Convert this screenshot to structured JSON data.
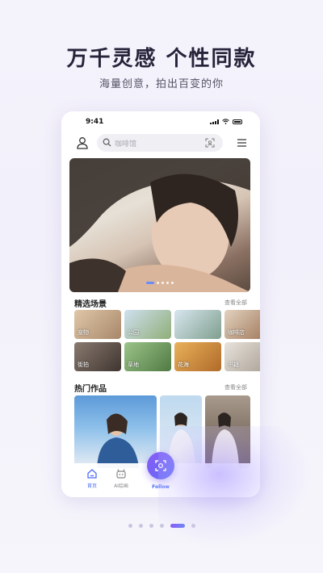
{
  "hero": {
    "title": "万千灵感 个性同款",
    "subtitle": "海量创意，拍出百变的你"
  },
  "status_bar": {
    "time": "9:41"
  },
  "search": {
    "placeholder": "咖啡馆"
  },
  "banner": {
    "slide_count": 5,
    "active_slide": 1
  },
  "scenes": {
    "title": "精选场景",
    "more": "查看全部",
    "items": [
      {
        "label": "宠物",
        "color": "#c9a27a"
      },
      {
        "label": "公园",
        "color": "#9bb58a"
      },
      {
        "label": "",
        "color": "#8fa9a0"
      },
      {
        "label": "咖啡店",
        "color": "#b48b6a"
      },
      {
        "label": "街拍",
        "color": "#6d5d54"
      },
      {
        "label": "草地",
        "color": "#6f9a5e"
      },
      {
        "label": "花海",
        "color": "#c98b3e"
      },
      {
        "label": "书籍",
        "color": "#bfb8ae"
      }
    ]
  },
  "works": {
    "title": "热门作品",
    "more": "查看全部"
  },
  "bottom_nav": {
    "home": "首页",
    "ai_draw": "AI绘画",
    "follow": "Follow",
    "accent": "#4a6cf7"
  },
  "pager": {
    "count": 6,
    "active": 5
  }
}
